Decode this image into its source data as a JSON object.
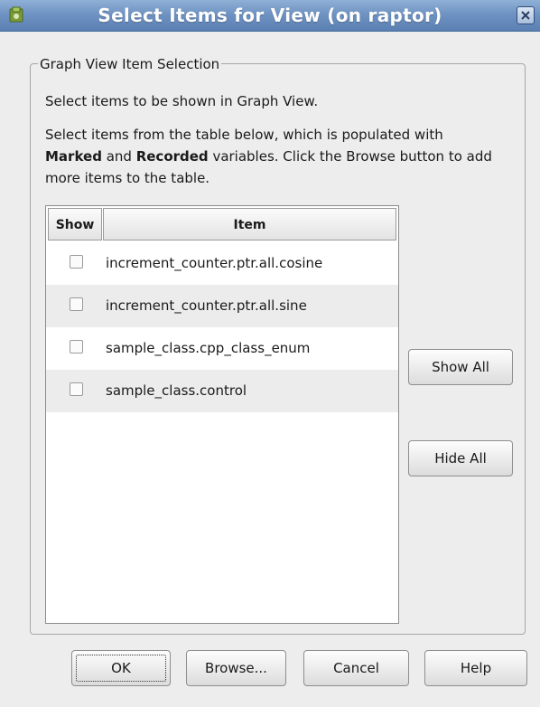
{
  "window": {
    "title": "Select Items for View (on raptor)",
    "title_bar_color": "#6f93c2"
  },
  "group": {
    "legend": "Graph View Item Selection",
    "intro": "Select items to be shown in Graph View.",
    "instructions": {
      "part1": "Select items from the table below, which is populated with ",
      "bold1": "Marked",
      "part2": " and ",
      "bold2": "Recorded",
      "part3": " variables. Click the Browse button to add more items to the table."
    }
  },
  "table": {
    "headers": {
      "show": "Show",
      "item": "Item"
    },
    "rows": [
      {
        "show": false,
        "item": "increment_counter.ptr.all.cosine"
      },
      {
        "show": false,
        "item": "increment_counter.ptr.all.sine"
      },
      {
        "show": false,
        "item": "sample_class.cpp_class_enum"
      },
      {
        "show": false,
        "item": "sample_class.control"
      }
    ]
  },
  "side_buttons": {
    "show_all": "Show All",
    "hide_all": "Hide All"
  },
  "footer_buttons": {
    "ok": "OK",
    "browse": "Browse...",
    "cancel": "Cancel",
    "help": "Help"
  },
  "icons": {
    "app": "app-icon",
    "close": "close-icon",
    "checkbox": "checkbox-icon"
  }
}
